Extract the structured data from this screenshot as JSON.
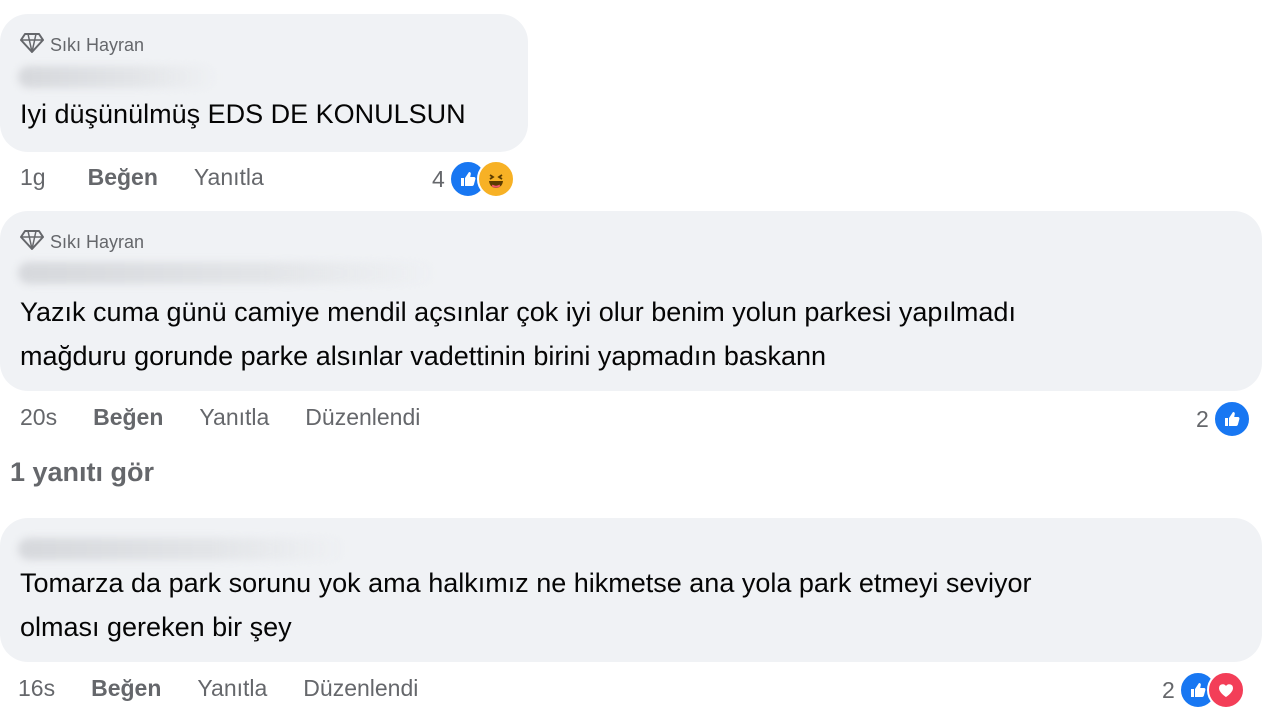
{
  "comments": [
    {
      "badge": "Sıkı Hayran",
      "text_lines": [
        "Iyi düşünülmüş EDS DE KONULSUN"
      ],
      "time": "1g",
      "like_label": "Beğen",
      "reply_label": "Yanıtla",
      "edited_label": "",
      "reaction_count": "4",
      "reactions": [
        "like-icon",
        "haha-icon"
      ]
    },
    {
      "badge": "Sıkı Hayran",
      "text_lines": [
        "Yazık cuma günü camiye mendil açsınlar çok iyi olur benim yolun parkesi yapılmadı",
        "mağduru gorunde parke alsınlar vadettinin birini yapmadın baskann"
      ],
      "time": "20s",
      "like_label": "Beğen",
      "reply_label": "Yanıtla",
      "edited_label": "Düzenlendi",
      "reaction_count": "2",
      "reactions": [
        "like-icon"
      ]
    },
    {
      "badge": "",
      "text_lines": [
        "Tomarza da park sorunu yok ama halkımız ne hikmetse ana yola park etmeyi seviyor",
        "olması gereken bir şey"
      ],
      "time": "16s",
      "like_label": "Beğen",
      "reply_label": "Yanıtla",
      "edited_label": "Düzenlendi",
      "reaction_count": "2",
      "reactions": [
        "like-icon",
        "love-icon"
      ]
    }
  ],
  "view_replies_label": "1 yanıtı gör",
  "colors": {
    "bubble": "#f0f2f5",
    "meta_text": "#65676b",
    "like": "#1877f2",
    "love": "#f33e58",
    "haha": "#f7b125"
  }
}
